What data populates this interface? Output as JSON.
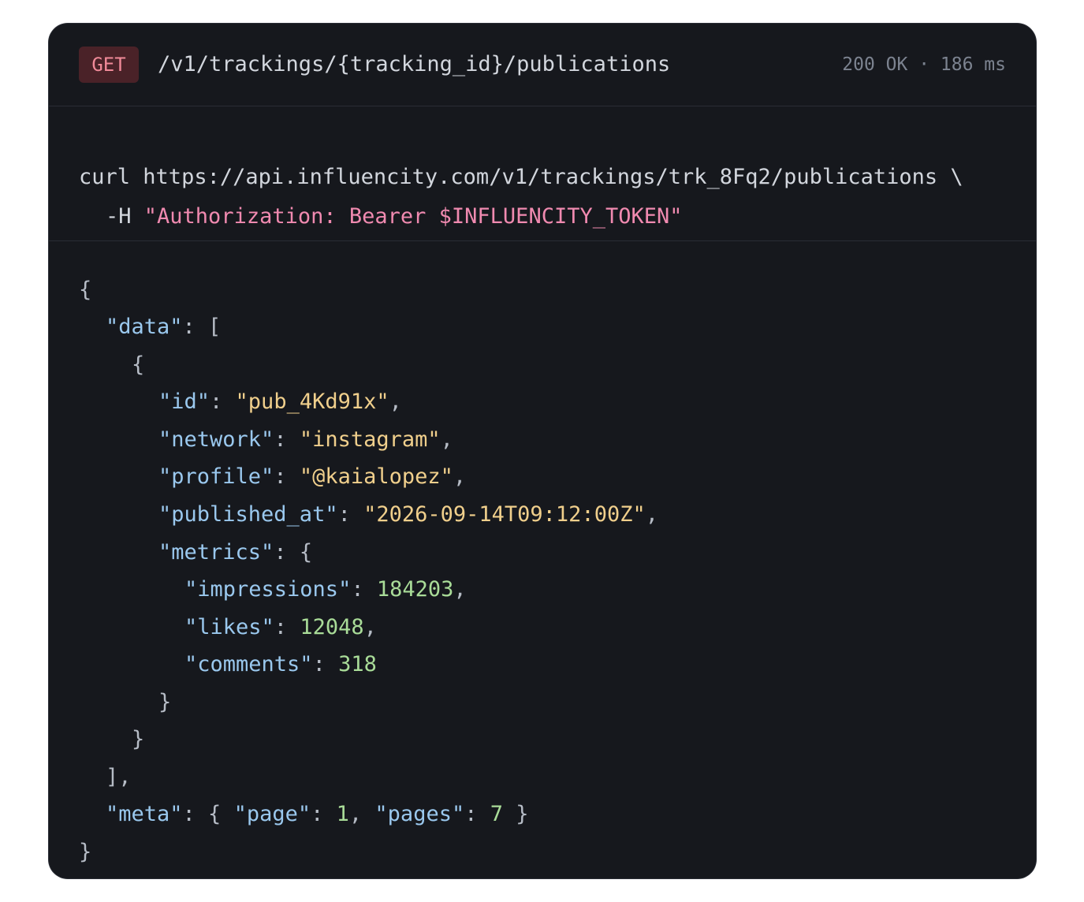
{
  "request": {
    "method": "GET",
    "path": "/v1/trackings/{tracking_id}/publications",
    "status": "200 OK · 186 ms",
    "curl_cmd": "curl",
    "url": "https://api.influencity.com/v1/trackings/trk_8Fq2/publications",
    "line_continuation": "\\",
    "header_flag": "-H",
    "header_value": "\"Authorization: Bearer $INFLUENCITY_TOKEN\""
  },
  "response": {
    "data_key": "\"data\"",
    "id_key": "\"id\"",
    "id_value": "\"pub_4Kd91x\"",
    "network_key": "\"network\"",
    "network_value": "\"instagram\"",
    "profile_key": "\"profile\"",
    "profile_value": "\"@kaialopez\"",
    "published_at_key": "\"published_at\"",
    "published_at_value": "\"2026-09-14T09:12:00Z\"",
    "metrics_key": "\"metrics\"",
    "impressions_key": "\"impressions\"",
    "impressions_value": "184203",
    "likes_key": "\"likes\"",
    "likes_value": "12048",
    "comments_key": "\"comments\"",
    "comments_value": "318",
    "meta_key": "\"meta\"",
    "page_key": "\"page\"",
    "page_value": "1",
    "pages_key": "\"pages\"",
    "pages_value": "7"
  },
  "colors": {
    "background": "#16181d",
    "method_badge": "#4a2228",
    "method_text": "#f08a99",
    "json_key": "#9ac8ee",
    "json_string": "#f0cf8c",
    "json_number": "#a9dc98",
    "header_string": "#f08ab0"
  }
}
